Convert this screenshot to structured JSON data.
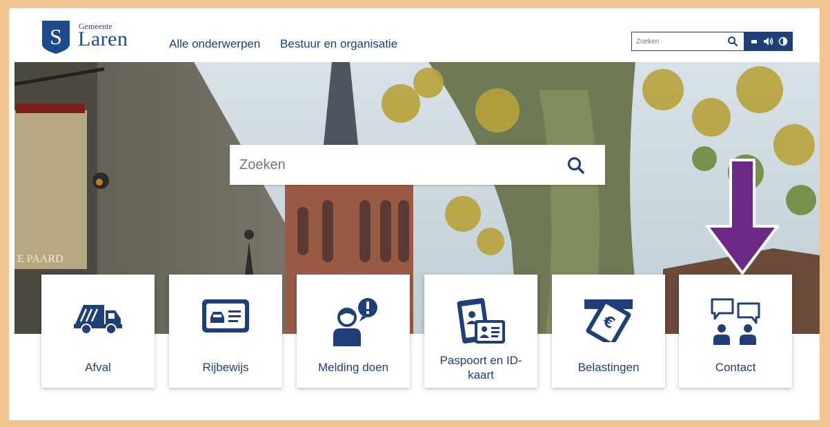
{
  "header": {
    "logo_small": "Gemeente",
    "logo_big": "Laren",
    "logo_letter": "S",
    "nav": [
      "Alle onderwerpen",
      "Bestuur en organisatie"
    ],
    "search_placeholder": "Zoeken"
  },
  "hero": {
    "search_placeholder": "Zoeken",
    "sign_text": "E PAARD"
  },
  "tiles": [
    {
      "label": "Afval",
      "icon": "garbage-truck-icon"
    },
    {
      "label": "Rijbewijs",
      "icon": "driving-license-icon"
    },
    {
      "label": "Melding doen",
      "icon": "report-person-icon"
    },
    {
      "label": "Paspoort en ID-kaart",
      "icon": "passport-id-icon"
    },
    {
      "label": "Belastingen",
      "icon": "tax-payment-icon"
    },
    {
      "label": "Contact",
      "icon": "contact-chat-icon"
    }
  ],
  "colors": {
    "brand": "#1f3f78",
    "frame": "#f0c58f",
    "arrow": "#6a2a86"
  }
}
